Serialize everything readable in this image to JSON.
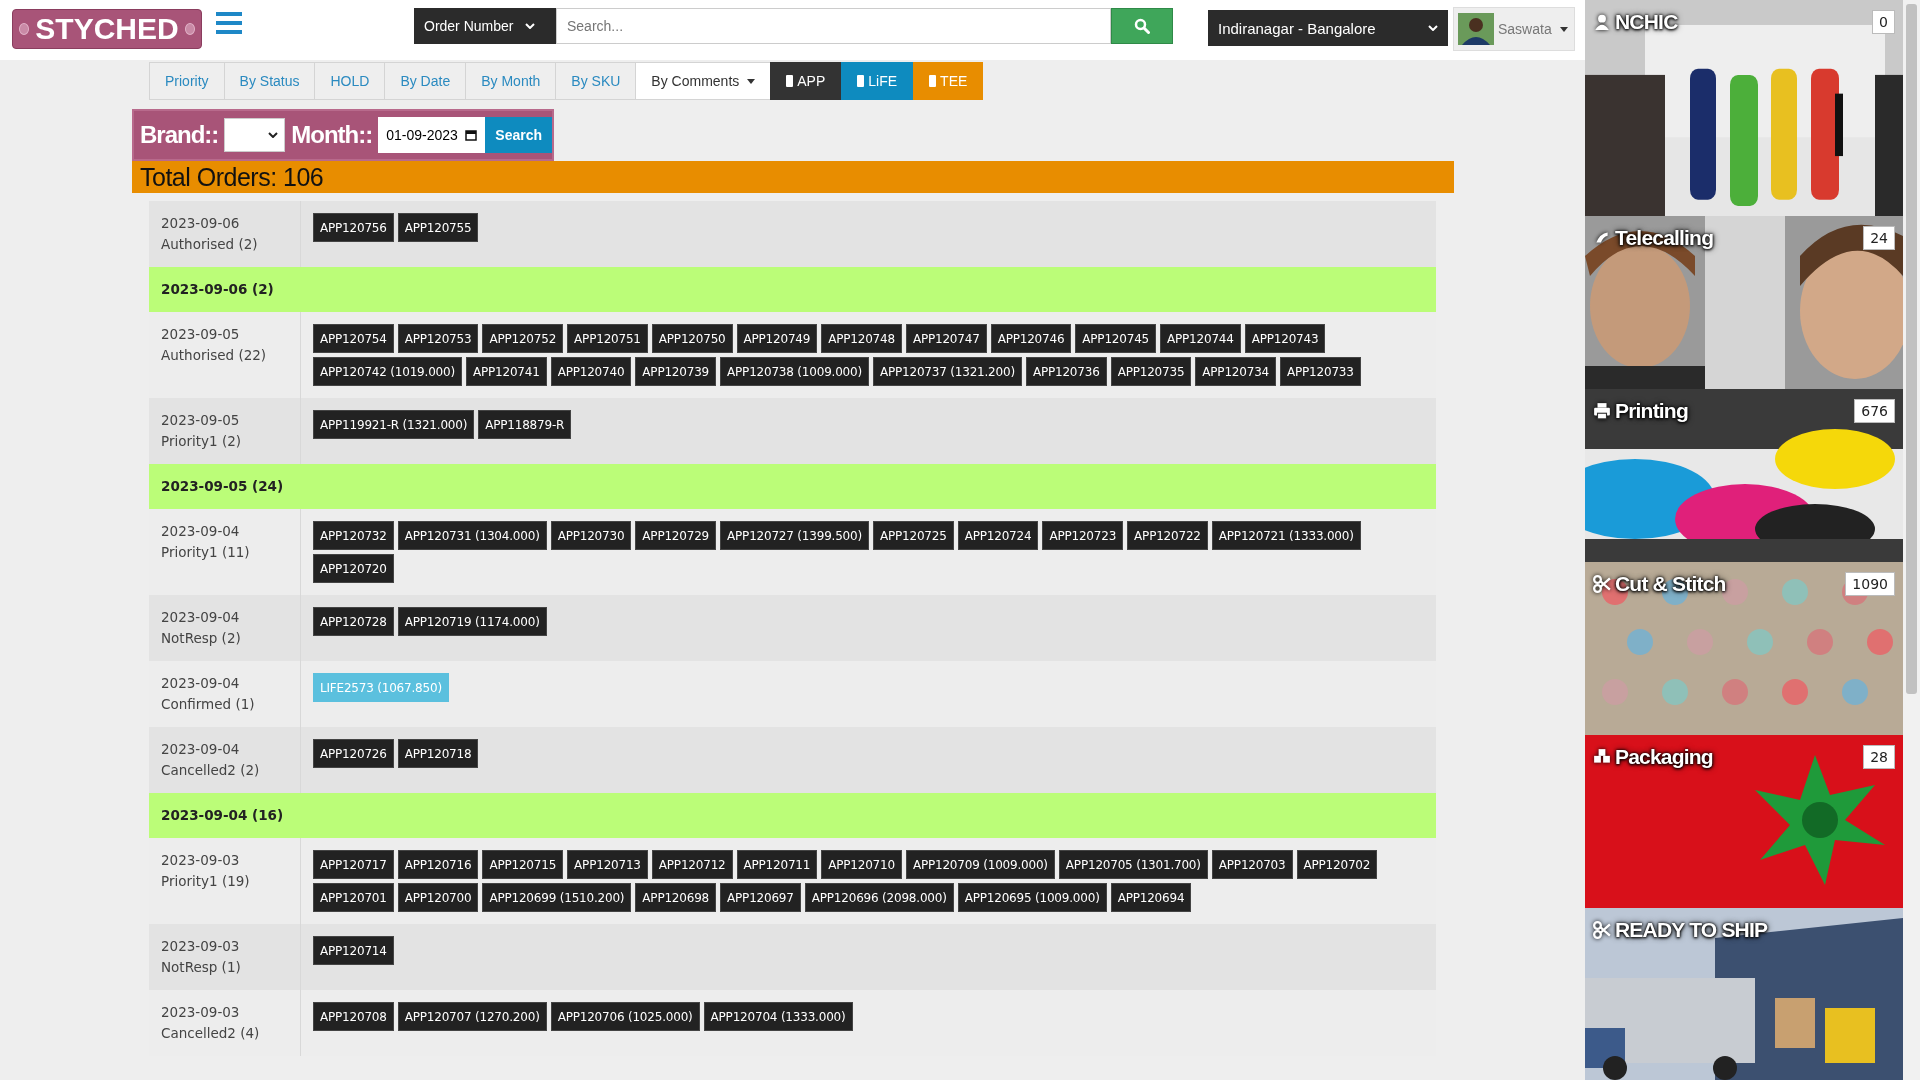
{
  "header": {
    "logo": "STYCHED",
    "search_type": "Order Number",
    "search_placeholder": "Search...",
    "location": "Indiranagar - Bangalore",
    "user": "Saswata"
  },
  "tabs": [
    {
      "label": "Priority",
      "kind": "plain",
      "selected": false
    },
    {
      "label": "By Status",
      "kind": "plain",
      "selected": false
    },
    {
      "label": "HOLD",
      "kind": "plain",
      "selected": false
    },
    {
      "label": "By Date",
      "kind": "plain",
      "selected": false
    },
    {
      "label": "By Month",
      "kind": "plain",
      "selected": false
    },
    {
      "label": "By SKU",
      "kind": "plain",
      "selected": false
    },
    {
      "label": "By Comments",
      "kind": "dropdown",
      "selected": true
    },
    {
      "label": "APP",
      "kind": "brand",
      "color": "#333333",
      "selected": false
    },
    {
      "label": "LiFE",
      "kind": "brand",
      "color": "#0e8bbf",
      "selected": false
    },
    {
      "label": "TEE",
      "kind": "brand",
      "color": "#e88d00",
      "selected": false
    }
  ],
  "filter": {
    "brand_label": "Brand::",
    "month_label": "Month::",
    "month_value": "01-09-2023",
    "button": "Search"
  },
  "total": "Total Orders: 106",
  "rows": [
    {
      "kind": "orders",
      "date": "2023-09-06",
      "status": "Authorised (2)",
      "tags": [
        {
          "label": "APP120756",
          "kind": "app"
        },
        {
          "label": "APP120755",
          "kind": "app"
        }
      ]
    },
    {
      "kind": "summary",
      "label": "2023-09-06 (2)"
    },
    {
      "kind": "orders",
      "date": "2023-09-05",
      "status": "Authorised (22)",
      "tags": [
        {
          "label": "APP120754",
          "kind": "app"
        },
        {
          "label": "APP120753",
          "kind": "app"
        },
        {
          "label": "APP120752",
          "kind": "app"
        },
        {
          "label": "APP120751",
          "kind": "app"
        },
        {
          "label": "APP120750",
          "kind": "app"
        },
        {
          "label": "APP120749",
          "kind": "app"
        },
        {
          "label": "APP120748",
          "kind": "app"
        },
        {
          "label": "APP120747",
          "kind": "app"
        },
        {
          "label": "APP120746",
          "kind": "app"
        },
        {
          "label": "APP120745",
          "kind": "app"
        },
        {
          "label": "APP120744",
          "kind": "app"
        },
        {
          "label": "APP120743",
          "kind": "app"
        },
        {
          "label": "APP120742 (1019.000)",
          "kind": "app"
        },
        {
          "label": "APP120741",
          "kind": "app"
        },
        {
          "label": "APP120740",
          "kind": "app"
        },
        {
          "label": "APP120739",
          "kind": "app"
        },
        {
          "label": "APP120738 (1009.000)",
          "kind": "app"
        },
        {
          "label": "APP120737 (1321.200)",
          "kind": "app"
        },
        {
          "label": "APP120736",
          "kind": "app"
        },
        {
          "label": "APP120735",
          "kind": "app"
        },
        {
          "label": "APP120734",
          "kind": "app"
        },
        {
          "label": "APP120733",
          "kind": "app"
        }
      ]
    },
    {
      "kind": "orders",
      "date": "2023-09-05",
      "status": "Priority1 (2)",
      "tags": [
        {
          "label": "APP119921-R (1321.000)",
          "kind": "app"
        },
        {
          "label": "APP118879-R",
          "kind": "app"
        }
      ]
    },
    {
      "kind": "summary",
      "label": "2023-09-05 (24)"
    },
    {
      "kind": "orders",
      "date": "2023-09-04",
      "status": "Priority1 (11)",
      "tags": [
        {
          "label": "APP120732",
          "kind": "app"
        },
        {
          "label": "APP120731 (1304.000)",
          "kind": "app"
        },
        {
          "label": "APP120730",
          "kind": "app"
        },
        {
          "label": "APP120729",
          "kind": "app"
        },
        {
          "label": "APP120727 (1399.500)",
          "kind": "app"
        },
        {
          "label": "APP120725",
          "kind": "app"
        },
        {
          "label": "APP120724",
          "kind": "app"
        },
        {
          "label": "APP120723",
          "kind": "app"
        },
        {
          "label": "APP120722",
          "kind": "app"
        },
        {
          "label": "APP120721 (1333.000)",
          "kind": "app"
        },
        {
          "label": "APP120720",
          "kind": "app"
        }
      ]
    },
    {
      "kind": "orders",
      "date": "2023-09-04",
      "status": "NotResp (2)",
      "tags": [
        {
          "label": "APP120728",
          "kind": "app"
        },
        {
          "label": "APP120719 (1174.000)",
          "kind": "app"
        }
      ]
    },
    {
      "kind": "orders",
      "date": "2023-09-04",
      "status": "Confirmed (1)",
      "tags": [
        {
          "label": "LIFE2573 (1067.850)",
          "kind": "life"
        }
      ]
    },
    {
      "kind": "orders",
      "date": "2023-09-04",
      "status": "Cancelled2 (2)",
      "tags": [
        {
          "label": "APP120726",
          "kind": "app"
        },
        {
          "label": "APP120718",
          "kind": "app"
        }
      ]
    },
    {
      "kind": "summary",
      "label": "2023-09-04 (16)"
    },
    {
      "kind": "orders",
      "date": "2023-09-03",
      "status": "Priority1 (19)",
      "tags": [
        {
          "label": "APP120717",
          "kind": "app"
        },
        {
          "label": "APP120716",
          "kind": "app"
        },
        {
          "label": "APP120715",
          "kind": "app"
        },
        {
          "label": "APP120713",
          "kind": "app"
        },
        {
          "label": "APP120712",
          "kind": "app"
        },
        {
          "label": "APP120711",
          "kind": "app"
        },
        {
          "label": "APP120710",
          "kind": "app"
        },
        {
          "label": "APP120709 (1009.000)",
          "kind": "app"
        },
        {
          "label": "APP120705 (1301.700)",
          "kind": "app"
        },
        {
          "label": "APP120703",
          "kind": "app"
        },
        {
          "label": "APP120702",
          "kind": "app"
        },
        {
          "label": "APP120701",
          "kind": "app"
        },
        {
          "label": "APP120700",
          "kind": "app"
        },
        {
          "label": "APP120699 (1510.200)",
          "kind": "app"
        },
        {
          "label": "APP120698",
          "kind": "app"
        },
        {
          "label": "APP120697",
          "kind": "app"
        },
        {
          "label": "APP120696 (2098.000)",
          "kind": "app"
        },
        {
          "label": "APP120695 (1009.000)",
          "kind": "app"
        },
        {
          "label": "APP120694",
          "kind": "app"
        }
      ]
    },
    {
      "kind": "orders",
      "date": "2023-09-03",
      "status": "NotResp (1)",
      "tags": [
        {
          "label": "APP120714",
          "kind": "app"
        }
      ]
    },
    {
      "kind": "orders",
      "date": "2023-09-03",
      "status": "Cancelled2 (4)",
      "tags": [
        {
          "label": "APP120708",
          "kind": "app"
        },
        {
          "label": "APP120707 (1270.200)",
          "kind": "app"
        },
        {
          "label": "APP120706 (1025.000)",
          "kind": "app"
        },
        {
          "label": "APP120704 (1333.000)",
          "kind": "app"
        }
      ]
    }
  ],
  "panels": [
    {
      "title": "NCHIC",
      "count": "0"
    },
    {
      "title": "Telecalling",
      "count": "24"
    },
    {
      "title": "Printing",
      "count": "676"
    },
    {
      "title": "Cut & Stitch",
      "count": "1090"
    },
    {
      "title": "Packaging",
      "count": "28"
    },
    {
      "title": "READY TO SHIP"
    }
  ]
}
